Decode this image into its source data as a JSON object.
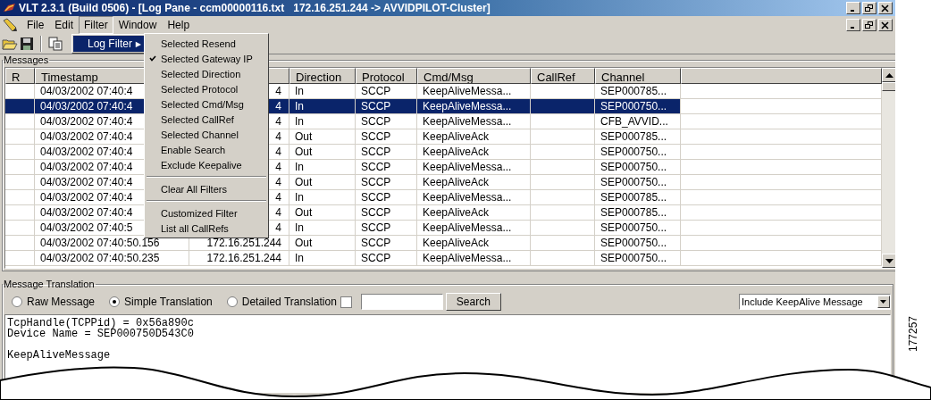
{
  "window": {
    "title": "VLT 2.3.1 (Build 0506) - [Log Pane - ccm00000116.txt   172.16.251.244 -> AVVIDPILOT-Cluster]"
  },
  "menu": [
    {
      "label": "File",
      "selected": false
    },
    {
      "label": "Edit",
      "selected": false
    },
    {
      "label": "Filter",
      "selected": true
    },
    {
      "label": "Window",
      "selected": false
    },
    {
      "label": "Help",
      "selected": false
    }
  ],
  "submenu": {
    "label": "Log Filter",
    "selected": true,
    "arrow": "▶"
  },
  "filter_menu": [
    {
      "kind": "item",
      "label": "Selected Resend",
      "checked": false
    },
    {
      "kind": "item",
      "label": "Selected Gateway IP",
      "checked": true
    },
    {
      "kind": "item",
      "label": "Selected Direction",
      "checked": false
    },
    {
      "kind": "item",
      "label": "Selected Protocol",
      "checked": false
    },
    {
      "kind": "item",
      "label": "Selected Cmd/Msg",
      "checked": false
    },
    {
      "kind": "item",
      "label": "Selected CallRef",
      "checked": false
    },
    {
      "kind": "item",
      "label": "Selected Channel",
      "checked": false
    },
    {
      "kind": "item",
      "label": "Enable Search",
      "checked": false
    },
    {
      "kind": "item",
      "label": "Exclude Keepalive",
      "checked": false
    },
    {
      "kind": "separator"
    },
    {
      "kind": "item",
      "label": "Clear All Filters",
      "checked": false
    },
    {
      "kind": "separator"
    },
    {
      "kind": "item",
      "label": "Customized Filter",
      "checked": false
    },
    {
      "kind": "item",
      "label": "List all CallRefs",
      "checked": false
    }
  ],
  "messages": {
    "title": "Messages",
    "columns": {
      "r": "R",
      "timestamp": "Timestamp",
      "direction": "Direction",
      "protocol": "Protocol",
      "cmd_msg": "Cmd/Msg",
      "callref": "CallRef",
      "channel": "Channel"
    },
    "rows": [
      {
        "timestamp": "04/03/2002 07:40:4",
        "column_3": "4",
        "direction": "In",
        "protocol": "SCCP",
        "cmd_msg": "KeepAliveMessa...",
        "channel": "SEP000785...",
        "selected": false
      },
      {
        "timestamp": "04/03/2002 07:40:4",
        "column_3": "4",
        "direction": "In",
        "protocol": "SCCP",
        "cmd_msg": "KeepAliveMessa...",
        "channel": "SEP000750...",
        "selected": true
      },
      {
        "timestamp": "04/03/2002 07:40:4",
        "column_3": "4",
        "direction": "In",
        "protocol": "SCCP",
        "cmd_msg": "KeepAliveMessa...",
        "channel": "CFB_AVVID...",
        "selected": false
      },
      {
        "timestamp": "04/03/2002 07:40:4",
        "column_3": "4",
        "direction": "Out",
        "protocol": "SCCP",
        "cmd_msg": "KeepAliveAck",
        "channel": "SEP000785...",
        "selected": false
      },
      {
        "timestamp": "04/03/2002 07:40:4",
        "column_3": "4",
        "direction": "Out",
        "protocol": "SCCP",
        "cmd_msg": "KeepAliveAck",
        "channel": "SEP000750...",
        "selected": false
      },
      {
        "timestamp": "04/03/2002 07:40:4",
        "column_3": "4",
        "direction": "In",
        "protocol": "SCCP",
        "cmd_msg": "KeepAliveMessa...",
        "channel": "SEP000750...",
        "selected": false
      },
      {
        "timestamp": "04/03/2002 07:40:4",
        "column_3": "4",
        "direction": "Out",
        "protocol": "SCCP",
        "cmd_msg": "KeepAliveAck",
        "channel": "SEP000750...",
        "selected": false
      },
      {
        "timestamp": "04/03/2002 07:40:4",
        "column_3": "4",
        "direction": "In",
        "protocol": "SCCP",
        "cmd_msg": "KeepAliveMessa...",
        "channel": "SEP000785...",
        "selected": false
      },
      {
        "timestamp": "04/03/2002 07:40:4",
        "column_3": "4",
        "direction": "Out",
        "protocol": "SCCP",
        "cmd_msg": "KeepAliveAck",
        "channel": "SEP000785...",
        "selected": false
      },
      {
        "timestamp": "04/03/2002 07:40:5",
        "column_3": "4",
        "direction": "In",
        "protocol": "SCCP",
        "cmd_msg": "KeepAliveMessa...",
        "channel": "SEP000750...",
        "selected": false
      },
      {
        "timestamp": "04/03/2002 07:40:50.156",
        "column_3": "172.16.251.244",
        "direction": "Out",
        "protocol": "SCCP",
        "cmd_msg": "KeepAliveAck",
        "channel": "SEP000750...",
        "selected": false
      },
      {
        "timestamp": "04/03/2002 07:40:50.235",
        "column_3": "172.16.251.244",
        "direction": "In",
        "protocol": "SCCP",
        "cmd_msg": "KeepAliveMessa...",
        "channel": "SEP000750...",
        "selected": false
      }
    ]
  },
  "translation": {
    "title": "Message Translation",
    "modes": [
      {
        "label": "Raw Message",
        "selected": false
      },
      {
        "label": "Simple Translation",
        "selected": true
      },
      {
        "label": "Detailed Translation",
        "selected": false
      }
    ],
    "checkbox": {
      "checked": false
    },
    "search_button": "Search",
    "filter_dropdown": {
      "value": "Include KeepAlive Message"
    },
    "output": "TcpHandle(TCPPid) = 0x56a890c\nDevice Name = SEP000750D543C0\n\nKeepAliveMessage"
  },
  "figure_number": "177257"
}
